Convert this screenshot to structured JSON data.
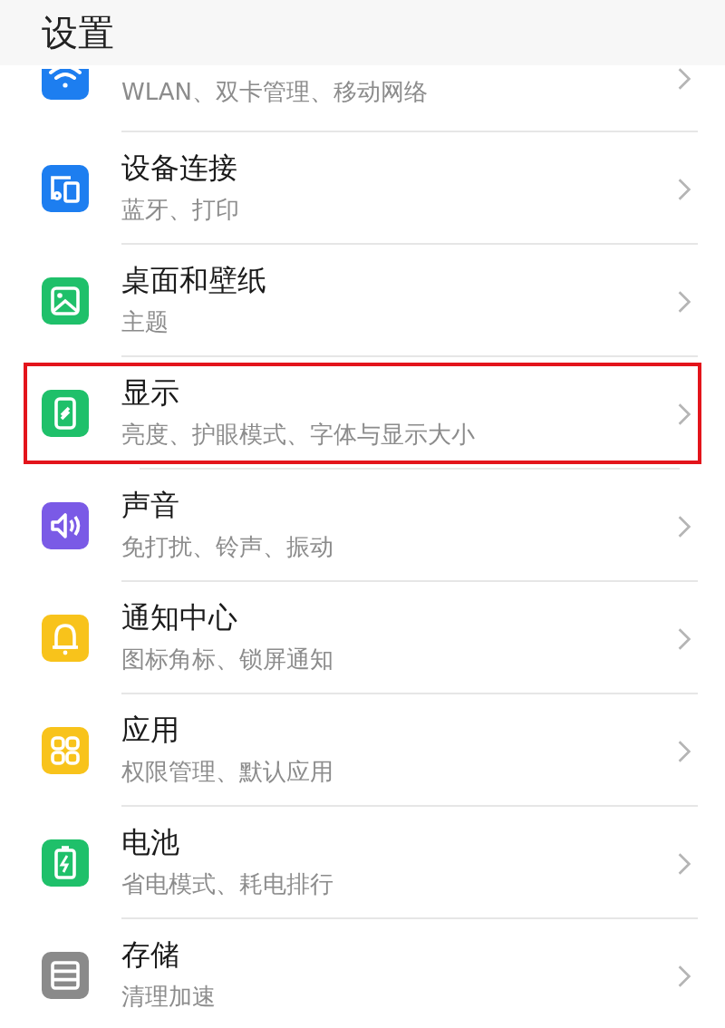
{
  "header": {
    "title": "设置"
  },
  "items": [
    {
      "kind": "wifi",
      "color": "#1d7ef0",
      "subtitle": "WLAN、双卡管理、移动网络",
      "highlighted": false
    },
    {
      "kind": "devices",
      "color": "#1d7ef0",
      "title": "设备连接",
      "subtitle": "蓝牙、打印",
      "highlighted": false
    },
    {
      "kind": "wallpaper",
      "color": "#1fc06a",
      "title": "桌面和壁纸",
      "subtitle": "主题",
      "highlighted": false
    },
    {
      "kind": "display",
      "color": "#1fc06a",
      "title": "显示",
      "subtitle": "亮度、护眼模式、字体与显示大小",
      "highlighted": true
    },
    {
      "kind": "sound",
      "color": "#7a5ae6",
      "title": "声音",
      "subtitle": "免打扰、铃声、振动",
      "highlighted": false
    },
    {
      "kind": "bell",
      "color": "#f8c31b",
      "title": "通知中心",
      "subtitle": "图标角标、锁屏通知",
      "highlighted": false
    },
    {
      "kind": "apps",
      "color": "#f8c31b",
      "title": "应用",
      "subtitle": "权限管理、默认应用",
      "highlighted": false
    },
    {
      "kind": "battery",
      "color": "#1fc06a",
      "title": "电池",
      "subtitle": "省电模式、耗电排行",
      "highlighted": false
    },
    {
      "kind": "storage",
      "color": "#8a8a8a",
      "title": "存储",
      "subtitle": "清理加速",
      "highlighted": false
    }
  ]
}
